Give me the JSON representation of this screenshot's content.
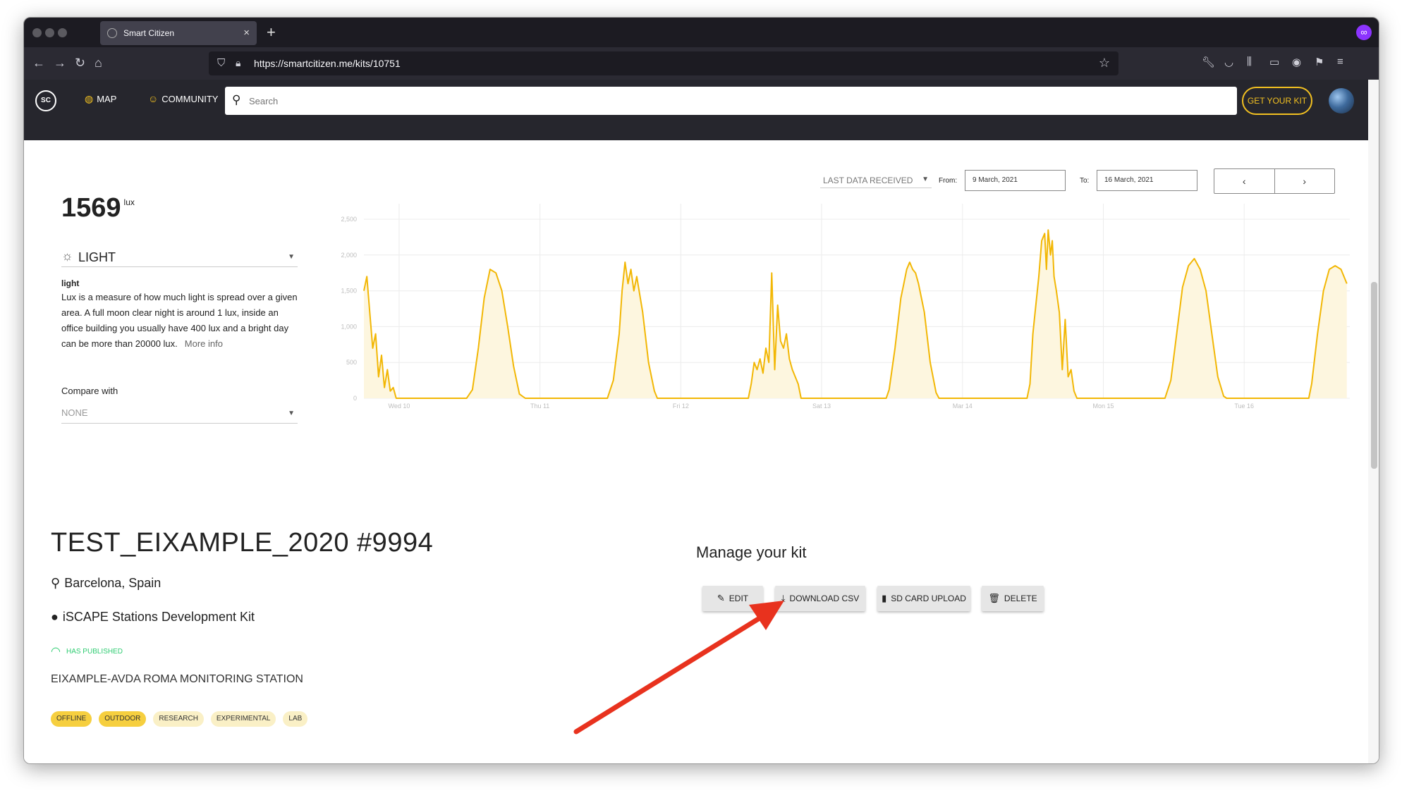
{
  "browser": {
    "tab_title": "Smart Citizen",
    "tab_close": "×",
    "new_tab": "+",
    "url": "https://smartcitizen.me/kits/10751"
  },
  "site": {
    "nav": [
      {
        "label": "MAP",
        "icon": "globe-icon"
      },
      {
        "label": "COMMUNITY",
        "icon": "community-icon"
      }
    ],
    "search_placeholder": "Search",
    "cta": "GET YOUR KIT"
  },
  "sensor": {
    "value": "1569",
    "unit": "lux",
    "selected": "LIGHT",
    "name": "light",
    "description": "Lux is a measure of how much light is spread over a given area. A full moon clear night is around 1 lux, inside an office building you usually have 400 lux and a bright day can be more than 20000 lux.",
    "more_info": "More info",
    "compare_label": "Compare with",
    "compare_value": "NONE"
  },
  "controls": {
    "range": "LAST DATA RECEIVED",
    "from_label": "From:",
    "from_value": "9 March, 2021",
    "to_label": "To:",
    "to_value": "16 March, 2021",
    "prev": "‹",
    "next": "›"
  },
  "chart_data": {
    "type": "area",
    "title": "",
    "xlabel": "",
    "ylabel": "",
    "color": "#f2b705",
    "fill": "#fdf6df",
    "ylim": [
      0,
      2500
    ],
    "y_ticks": [
      "2,500",
      "2,000",
      "1,500",
      "1,000",
      "500",
      "0"
    ],
    "x_ticks": [
      "Wed 10",
      "Thu 11",
      "Fri 12",
      "Sat 13",
      "Mar 14",
      "Mon 15",
      "Tue 16"
    ],
    "x_range_hours": [
      0,
      168
    ],
    "x_tick_hours": [
      6,
      30,
      54,
      78,
      102,
      126,
      150
    ],
    "series": [
      {
        "values": [
          [
            0.0,
            1500
          ],
          [
            0.5,
            1700
          ],
          [
            1.0,
            1200
          ],
          [
            1.5,
            700
          ],
          [
            2.0,
            900
          ],
          [
            2.5,
            300
          ],
          [
            3.0,
            600
          ],
          [
            3.5,
            150
          ],
          [
            4.0,
            400
          ],
          [
            4.5,
            100
          ],
          [
            5.0,
            150
          ],
          [
            5.5,
            0
          ],
          [
            17.5,
            0
          ],
          [
            18.5,
            120
          ],
          [
            19.5,
            700
          ],
          [
            20.5,
            1400
          ],
          [
            21.5,
            1800
          ],
          [
            22.5,
            1750
          ],
          [
            23.5,
            1500
          ],
          [
            24.5,
            1000
          ],
          [
            25.5,
            450
          ],
          [
            26.5,
            60
          ],
          [
            27.5,
            0
          ],
          [
            41.5,
            0
          ],
          [
            42.5,
            250
          ],
          [
            43.5,
            900
          ],
          [
            44.0,
            1500
          ],
          [
            44.5,
            1900
          ],
          [
            45.0,
            1600
          ],
          [
            45.5,
            1800
          ],
          [
            46.0,
            1500
          ],
          [
            46.5,
            1700
          ],
          [
            47.5,
            1200
          ],
          [
            48.5,
            500
          ],
          [
            49.5,
            100
          ],
          [
            50.0,
            0
          ],
          [
            65.5,
            0
          ],
          [
            66.0,
            200
          ],
          [
            66.5,
            500
          ],
          [
            67.0,
            400
          ],
          [
            67.5,
            550
          ],
          [
            68.0,
            350
          ],
          [
            68.5,
            700
          ],
          [
            69.0,
            500
          ],
          [
            69.5,
            1750
          ],
          [
            70.0,
            400
          ],
          [
            70.5,
            1300
          ],
          [
            71.0,
            800
          ],
          [
            71.5,
            700
          ],
          [
            72.0,
            900
          ],
          [
            72.5,
            550
          ],
          [
            73.0,
            400
          ],
          [
            74.0,
            200
          ],
          [
            74.5,
            0
          ],
          [
            89.0,
            0
          ],
          [
            89.5,
            120
          ],
          [
            90.5,
            700
          ],
          [
            91.5,
            1400
          ],
          [
            92.0,
            1600
          ],
          [
            92.5,
            1800
          ],
          [
            93.0,
            1900
          ],
          [
            93.5,
            1800
          ],
          [
            94.0,
            1750
          ],
          [
            94.5,
            1600
          ],
          [
            95.5,
            1200
          ],
          [
            96.5,
            500
          ],
          [
            97.5,
            80
          ],
          [
            98.0,
            0
          ],
          [
            113.0,
            0
          ],
          [
            113.5,
            200
          ],
          [
            114.0,
            900
          ],
          [
            114.5,
            1300
          ],
          [
            115.0,
            1700
          ],
          [
            115.5,
            2200
          ],
          [
            116.0,
            2300
          ],
          [
            116.3,
            1800
          ],
          [
            116.6,
            2350
          ],
          [
            117.0,
            2000
          ],
          [
            117.3,
            2200
          ],
          [
            117.6,
            1700
          ],
          [
            118.0,
            1500
          ],
          [
            118.5,
            1200
          ],
          [
            119.0,
            400
          ],
          [
            119.5,
            1100
          ],
          [
            120.0,
            300
          ],
          [
            120.5,
            400
          ],
          [
            121.0,
            100
          ],
          [
            121.5,
            0
          ],
          [
            136.5,
            0
          ],
          [
            137.5,
            250
          ],
          [
            138.5,
            900
          ],
          [
            139.5,
            1550
          ],
          [
            140.5,
            1850
          ],
          [
            141.5,
            1950
          ],
          [
            142.5,
            1800
          ],
          [
            143.5,
            1500
          ],
          [
            144.5,
            900
          ],
          [
            145.5,
            300
          ],
          [
            146.5,
            30
          ],
          [
            147.0,
            0
          ],
          [
            161.0,
            0
          ],
          [
            161.5,
            200
          ],
          [
            162.5,
            900
          ],
          [
            163.5,
            1500
          ],
          [
            164.5,
            1800
          ],
          [
            165.5,
            1850
          ],
          [
            166.5,
            1800
          ],
          [
            167.5,
            1600
          ]
        ]
      }
    ]
  },
  "kit": {
    "title": "TEST_EIXAMPLE_2020 #9994",
    "location": "Barcelona, Spain",
    "kit_type": "iSCAPE Stations Development Kit",
    "status": "HAS PUBLISHED",
    "description": "EIXAMPLE-AVDA ROMA MONITORING STATION",
    "tags": [
      {
        "label": "OFFLINE",
        "active": true
      },
      {
        "label": "OUTDOOR",
        "active": true
      },
      {
        "label": "RESEARCH",
        "active": false
      },
      {
        "label": "EXPERIMENTAL",
        "active": false
      },
      {
        "label": "LAB",
        "active": false
      }
    ]
  },
  "manage": {
    "title": "Manage your kit",
    "buttons": [
      {
        "label": "EDIT",
        "icon": "edit-icon"
      },
      {
        "label": "DOWNLOAD CSV",
        "icon": "download-icon"
      },
      {
        "label": "SD CARD UPLOAD",
        "icon": "sd-card-icon"
      },
      {
        "label": "DELETE",
        "icon": "trash-icon"
      }
    ]
  },
  "annotation": {
    "arrow_color": "#e8321e"
  }
}
